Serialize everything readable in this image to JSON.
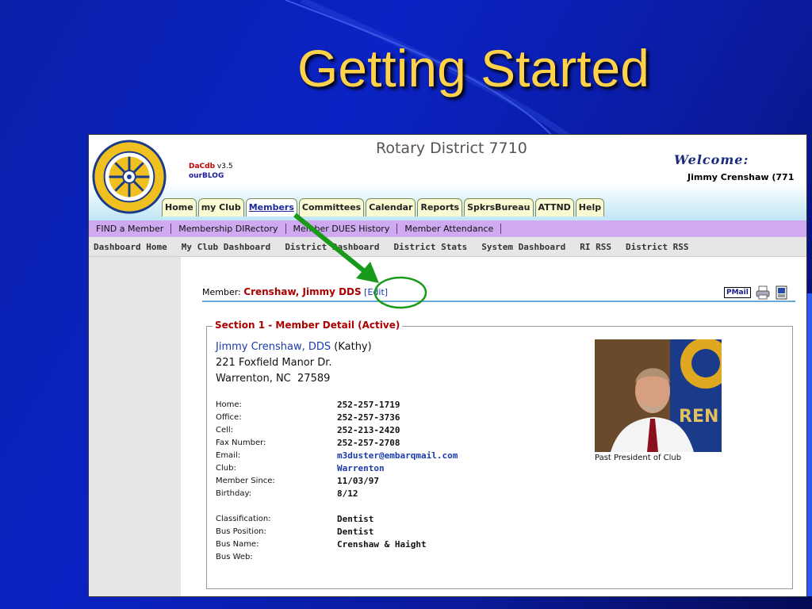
{
  "slide": {
    "title": "Getting Started"
  },
  "app": {
    "district_title": "Rotary District 7710",
    "brand": {
      "name": "DaCdb",
      "version": "v3.5",
      "blog": "ourBLOG"
    },
    "welcome_label": "Welcome:",
    "welcome_user": "Jimmy Crenshaw (771"
  },
  "tabs": [
    "Home",
    "my Club",
    "Members",
    "Committees",
    "Calendar",
    "Reports",
    "SpkrsBureau",
    "ATTND",
    "Help"
  ],
  "active_tab": "Members",
  "subnav": [
    "FIND a Member",
    "Membership DIRectory",
    "Member DUES History",
    "Member Attendance"
  ],
  "dashnav": [
    "Dashboard Home",
    "My Club Dashboard",
    "District Dashboard",
    "District Stats",
    "System Dashboard",
    "RI RSS",
    "District RSS"
  ],
  "member": {
    "label": "Member:",
    "name": "Crenshaw, Jimmy DDS",
    "edit_label": "[Edit]"
  },
  "toolbar": {
    "pmail_label": "PMail"
  },
  "section": {
    "legend": "Section 1 - Member Detail (Active)",
    "full_name": "Jimmy Crenshaw, DDS",
    "nickname": "(Kathy)",
    "address1": "221 Foxfield Manor Dr.",
    "address2": "Warrenton, NC  27589",
    "contact": [
      {
        "label": "Home:",
        "value": "252-257-1719"
      },
      {
        "label": "Office:",
        "value": "252-257-3736"
      },
      {
        "label": "Cell:",
        "value": "252-213-2420"
      },
      {
        "label": "Fax Number:",
        "value": "252-257-2708"
      },
      {
        "label": "Email:",
        "value": "m3duster@embarqmail.com"
      },
      {
        "label": "Club:",
        "value": "Warrenton"
      },
      {
        "label": "Member Since:",
        "value": "11/03/97"
      },
      {
        "label": "Birthday:",
        "value": "8/12"
      }
    ],
    "business": [
      {
        "label": "Classification:",
        "value": "Dentist"
      },
      {
        "label": "Bus Position:",
        "value": "Dentist"
      },
      {
        "label": "Bus Name:",
        "value": "Crenshaw & Haight"
      },
      {
        "label": "Bus Web:",
        "value": ""
      }
    ],
    "photo_caption": "Past President of Club",
    "photo_text": "REN"
  },
  "colors": {
    "title": "#ffd24a",
    "background": "#0b23c4",
    "annotation_arrow": "#1a9a1a",
    "member_name": "#aa0000",
    "link": "#1a3aaa",
    "subnav": "#cfaaf0"
  },
  "icons": [
    "rotary-logo",
    "pmail-icon",
    "print-icon",
    "word-doc-icon"
  ]
}
